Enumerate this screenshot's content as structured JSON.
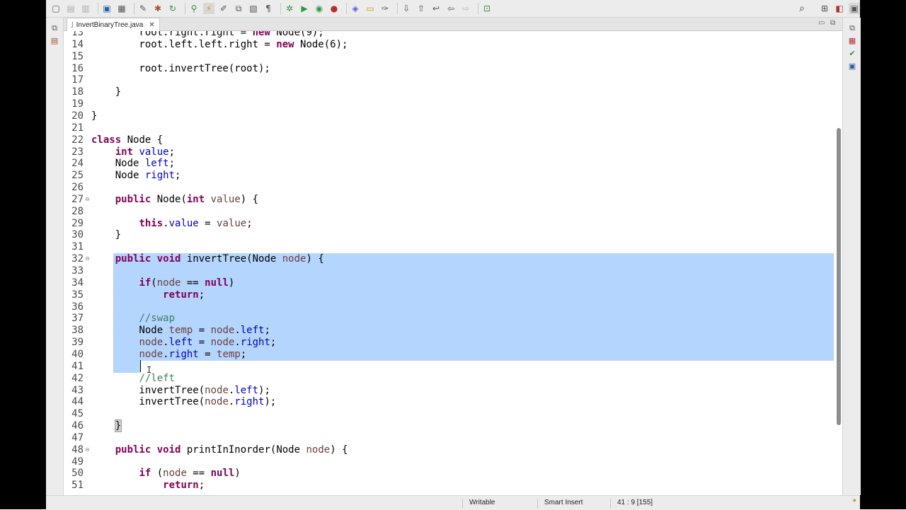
{
  "toolbar": {
    "icons": [
      "new-icon",
      "save-icon",
      "save-all-icon",
      "print-icon",
      "terminal-icon",
      "cut-icon",
      "build-icon",
      "debug-icon",
      "run-icon",
      "coverage-icon",
      "search-icon",
      "perspective-icon"
    ]
  },
  "editor_tab": {
    "file_icon": "J",
    "label": "InvertBinaryTree.java",
    "close_glyph": "✕"
  },
  "code_lines": [
    {
      "n": "13",
      "t": [
        [
          "        root.right.right = "
        ],
        [
          "new",
          "kw"
        ],
        [
          " Node(9);"
        ]
      ]
    },
    {
      "n": "14",
      "t": [
        [
          "        root.left.left.right = "
        ],
        [
          "new",
          "kw"
        ],
        [
          " Node(6);"
        ]
      ]
    },
    {
      "n": "15",
      "t": []
    },
    {
      "n": "16",
      "t": [
        [
          "        root.invertTree(root);"
        ]
      ]
    },
    {
      "n": "17",
      "t": []
    },
    {
      "n": "18",
      "t": [
        [
          "    }"
        ]
      ]
    },
    {
      "n": "19",
      "t": []
    },
    {
      "n": "20",
      "t": [
        [
          "}"
        ]
      ]
    },
    {
      "n": "21",
      "t": []
    },
    {
      "n": "22",
      "t": [
        [
          "class",
          "kw"
        ],
        [
          " Node {"
        ]
      ]
    },
    {
      "n": "23",
      "t": [
        [
          "    "
        ],
        [
          "int",
          "kw"
        ],
        [
          " "
        ],
        [
          "value",
          "fld"
        ],
        [
          ";"
        ]
      ]
    },
    {
      "n": "24",
      "t": [
        [
          "    Node "
        ],
        [
          "left",
          "fld"
        ],
        [
          ";"
        ]
      ]
    },
    {
      "n": "25",
      "t": [
        [
          "    Node "
        ],
        [
          "right",
          "fld"
        ],
        [
          ";"
        ]
      ]
    },
    {
      "n": "26",
      "t": []
    },
    {
      "n": "27",
      "fold": true,
      "t": [
        [
          "    "
        ],
        [
          "public",
          "kw"
        ],
        [
          " Node("
        ],
        [
          "int",
          "kw"
        ],
        [
          " "
        ],
        [
          "value",
          "prm"
        ],
        [
          ") {"
        ]
      ]
    },
    {
      "n": "28",
      "t": []
    },
    {
      "n": "29",
      "t": [
        [
          "        "
        ],
        [
          "this",
          "kw"
        ],
        [
          "."
        ],
        [
          "value",
          "fld"
        ],
        [
          " = "
        ],
        [
          "value",
          "prm"
        ],
        [
          ";"
        ]
      ]
    },
    {
      "n": "30",
      "t": [
        [
          "    }"
        ]
      ]
    },
    {
      "n": "31",
      "t": []
    },
    {
      "n": "32",
      "sel": true,
      "fold": true,
      "t": [
        [
          "    "
        ],
        [
          "public",
          "kw"
        ],
        [
          " "
        ],
        [
          "void",
          "kw"
        ],
        [
          " invertTree(Node "
        ],
        [
          "node",
          "prm"
        ],
        [
          ") {"
        ]
      ]
    },
    {
      "n": "33",
      "sel": true,
      "t": []
    },
    {
      "n": "34",
      "sel": true,
      "t": [
        [
          "        "
        ],
        [
          "if",
          "kw"
        ],
        [
          "("
        ],
        [
          "node",
          "prm"
        ],
        [
          " == "
        ],
        [
          "null",
          "kw"
        ],
        [
          ")"
        ]
      ]
    },
    {
      "n": "35",
      "sel": true,
      "t": [
        [
          "            "
        ],
        [
          "return",
          "kw"
        ],
        [
          ";"
        ]
      ]
    },
    {
      "n": "36",
      "sel": true,
      "t": []
    },
    {
      "n": "37",
      "sel": true,
      "t": [
        [
          "        "
        ],
        [
          "//swap",
          "cmt"
        ]
      ]
    },
    {
      "n": "38",
      "sel": true,
      "t": [
        [
          "        Node "
        ],
        [
          "temp",
          "prm"
        ],
        [
          " = "
        ],
        [
          "node",
          "prm"
        ],
        [
          "."
        ],
        [
          "left",
          "fld"
        ],
        [
          ";"
        ]
      ]
    },
    {
      "n": "39",
      "sel": true,
      "t": [
        [
          "        "
        ],
        [
          "node",
          "prm"
        ],
        [
          "."
        ],
        [
          "left",
          "fld"
        ],
        [
          " = "
        ],
        [
          "node",
          "prm"
        ],
        [
          "."
        ],
        [
          "right",
          "fld"
        ],
        [
          ";"
        ]
      ]
    },
    {
      "n": "40",
      "sel": true,
      "t": [
        [
          "        "
        ],
        [
          "node",
          "prm"
        ],
        [
          "."
        ],
        [
          "right",
          "fld"
        ],
        [
          " = "
        ],
        [
          "temp",
          "prm"
        ],
        [
          ";"
        ]
      ]
    },
    {
      "n": "41",
      "sel": true,
      "partial": true,
      "t": []
    },
    {
      "n": "42",
      "t": [
        [
          "        "
        ],
        [
          "//left",
          "cmt"
        ]
      ]
    },
    {
      "n": "43",
      "t": [
        [
          "        invertTree("
        ],
        [
          "node",
          "prm"
        ],
        [
          "."
        ],
        [
          "left",
          "fld"
        ],
        [
          ");"
        ]
      ]
    },
    {
      "n": "44",
      "t": [
        [
          "        invertTree("
        ],
        [
          "node",
          "prm"
        ],
        [
          "."
        ],
        [
          "right",
          "fld"
        ],
        [
          ");"
        ]
      ]
    },
    {
      "n": "45",
      "t": []
    },
    {
      "n": "46",
      "t": [
        [
          "    "
        ],
        [
          "}",
          "brk"
        ]
      ]
    },
    {
      "n": "47",
      "t": []
    },
    {
      "n": "48",
      "fold": true,
      "t": [
        [
          "    "
        ],
        [
          "public",
          "kw"
        ],
        [
          " "
        ],
        [
          "void",
          "kw"
        ],
        [
          " printInInorder(Node "
        ],
        [
          "node",
          "prm"
        ],
        [
          ") {"
        ]
      ]
    },
    {
      "n": "49",
      "t": []
    },
    {
      "n": "50",
      "t": [
        [
          "        "
        ],
        [
          "if",
          "kw"
        ],
        [
          " ("
        ],
        [
          "node",
          "prm"
        ],
        [
          " == "
        ],
        [
          "null",
          "kw"
        ],
        [
          ")"
        ]
      ]
    },
    {
      "n": "51",
      "t": [
        [
          "            "
        ],
        [
          "return",
          "kw"
        ],
        [
          ";"
        ]
      ]
    }
  ],
  "status": {
    "writable": "Writable",
    "insert_mode": "Smart Insert",
    "position": "41 : 9 [155]"
  },
  "colors": {
    "selection": "#b4d5fe",
    "keyword": "#7f0055",
    "field": "#0000c0",
    "parameter": "#6a3e3e",
    "comment": "#3f7f5f"
  }
}
